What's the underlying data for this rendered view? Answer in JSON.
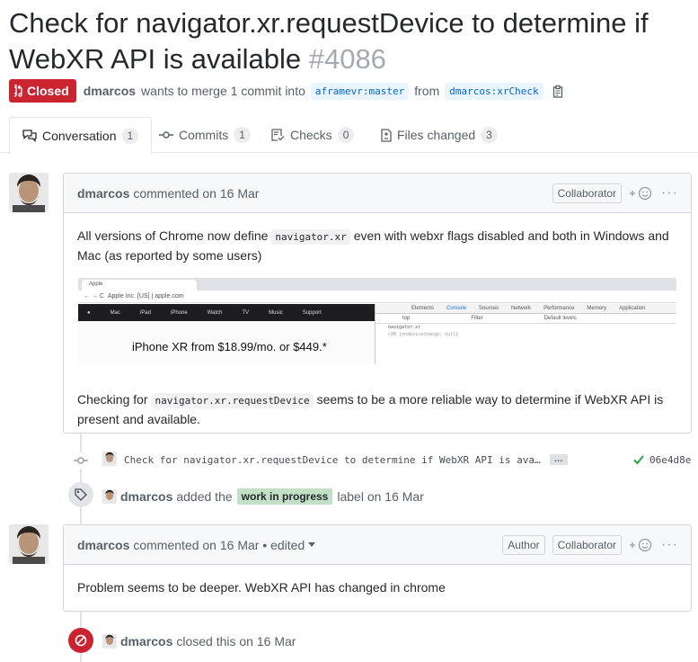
{
  "pr": {
    "title": "Check for navigator.xr.requestDevice to determine if WebXR API is available",
    "number": "#4086",
    "state": "Closed",
    "author": "dmarcos",
    "merge_text": "wants to merge 1 commit into",
    "base_branch": "aframevr:master",
    "from_text": "from",
    "head_branch": "dmarcos:xrCheck"
  },
  "tabs": [
    {
      "label": "Conversation",
      "count": "1",
      "icon": "comment-discussion-icon"
    },
    {
      "label": "Commits",
      "count": "1",
      "icon": "git-commit-icon"
    },
    {
      "label": "Checks",
      "count": "0",
      "icon": "checklist-icon"
    },
    {
      "label": "Files changed",
      "count": "3",
      "icon": "file-diff-icon"
    }
  ],
  "comment1": {
    "author": "dmarcos",
    "meta": "commented on 16 Mar",
    "role": "Collaborator",
    "p1_before": "All versions of Chrome now define",
    "p1_code": "navigator.xr",
    "p1_after": "even with webxr flags disabled and both in Windows and Mac (as reported by some users)",
    "p2_before": "Checking for",
    "p2_code": "navigator.xr.requestDevice",
    "p2_after": "seems to be a more reliable way to determine if WebXR API is present and available.",
    "screenshot": {
      "tab_title": "Apple",
      "address": "Apple Inc. [US] | apple.com",
      "nav_items": [
        "Mac",
        "iPad",
        "iPhone",
        "Watch",
        "TV",
        "Music",
        "Support"
      ],
      "hero": "iPhone XR from $18.99/mo. or $449.*",
      "devtools_tabs": [
        "Elements",
        "Console",
        "Sources",
        "Network",
        "Performance",
        "Memory",
        "Application"
      ],
      "devtools_context": "top",
      "devtools_filter": "Filter",
      "devtools_levels": "Default levels",
      "console_lines": [
        "navigator.xr",
        "▸XR {ondevicechange: null}"
      ]
    }
  },
  "commit": {
    "message": "Check for navigator.xr.requestDevice to determine if WebXR API is ava…",
    "ellipsis": "…",
    "sha": "06e4d8e"
  },
  "label_event": {
    "author": "dmarcos",
    "text_before": "added the",
    "label": "work in progress",
    "label_color": "#c2e0c6",
    "text_after": "label on 16 Mar"
  },
  "comment2": {
    "author": "dmarcos",
    "meta": "commented on 16 Mar • edited",
    "role1": "Author",
    "role2": "Collaborator",
    "body": "Problem seems to be deeper. WebXR API has changed in chrome"
  },
  "close_event": {
    "author": "dmarcos",
    "text": "closed this on 16 Mar"
  },
  "colors": {
    "closed": "#cb2431",
    "branch_bg": "#eaf5ff",
    "link": "#0366d6",
    "success": "#28a745"
  }
}
